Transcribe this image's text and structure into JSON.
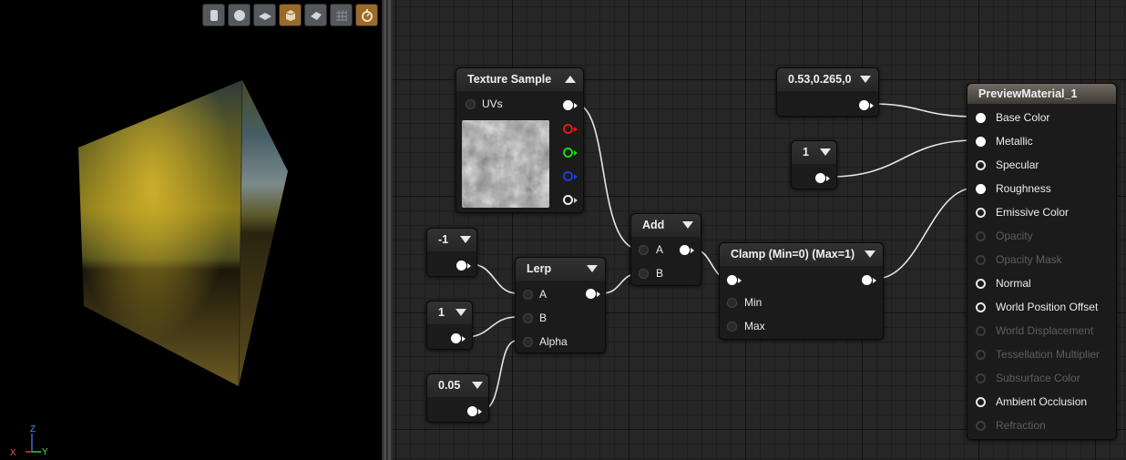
{
  "viewport": {
    "toolbar_buttons": [
      "cylinder-icon",
      "sphere-icon",
      "plane-icon",
      "cube-icon",
      "mesh-icon",
      "grid-icon",
      "realtime-icon"
    ],
    "axis": {
      "x": "X",
      "y": "Y",
      "z": "Z"
    }
  },
  "nodes": {
    "texture_sample": {
      "title": "Texture Sample",
      "uvs": "UVs"
    },
    "const_color": {
      "title": "0.53,0.265,0"
    },
    "const_metallic": {
      "title": "1"
    },
    "const_neg1": {
      "title": "-1"
    },
    "const_one": {
      "title": "1"
    },
    "const_alpha": {
      "title": "0.05"
    },
    "lerp": {
      "title": "Lerp",
      "a": "A",
      "b": "B",
      "alpha": "Alpha"
    },
    "add": {
      "title": "Add",
      "a": "A",
      "b": "B"
    },
    "clamp": {
      "title": "Clamp (Min=0) (Max=1)",
      "min": "Min",
      "max": "Max"
    },
    "material": {
      "title": "PreviewMaterial_1",
      "inputs": [
        {
          "label": "Base Color",
          "state": "connected"
        },
        {
          "label": "Metallic",
          "state": "connected"
        },
        {
          "label": "Specular",
          "state": "open"
        },
        {
          "label": "Roughness",
          "state": "connected"
        },
        {
          "label": "Emissive Color",
          "state": "open"
        },
        {
          "label": "Opacity",
          "state": "disabled"
        },
        {
          "label": "Opacity Mask",
          "state": "disabled"
        },
        {
          "label": "Normal",
          "state": "open"
        },
        {
          "label": "World Position Offset",
          "state": "open"
        },
        {
          "label": "World Displacement",
          "state": "disabled"
        },
        {
          "label": "Tessellation Multiplier",
          "state": "disabled"
        },
        {
          "label": "Subsurface Color",
          "state": "disabled"
        },
        {
          "label": "Ambient Occlusion",
          "state": "open"
        },
        {
          "label": "Refraction",
          "state": "disabled"
        }
      ]
    }
  },
  "colors": {
    "graph_bg": "#262626",
    "node_body": "#1b1b1b",
    "button_active": "#9a6a28",
    "pin_red": "#e01818",
    "pin_green": "#19d819",
    "pin_blue": "#1e3cdc"
  }
}
